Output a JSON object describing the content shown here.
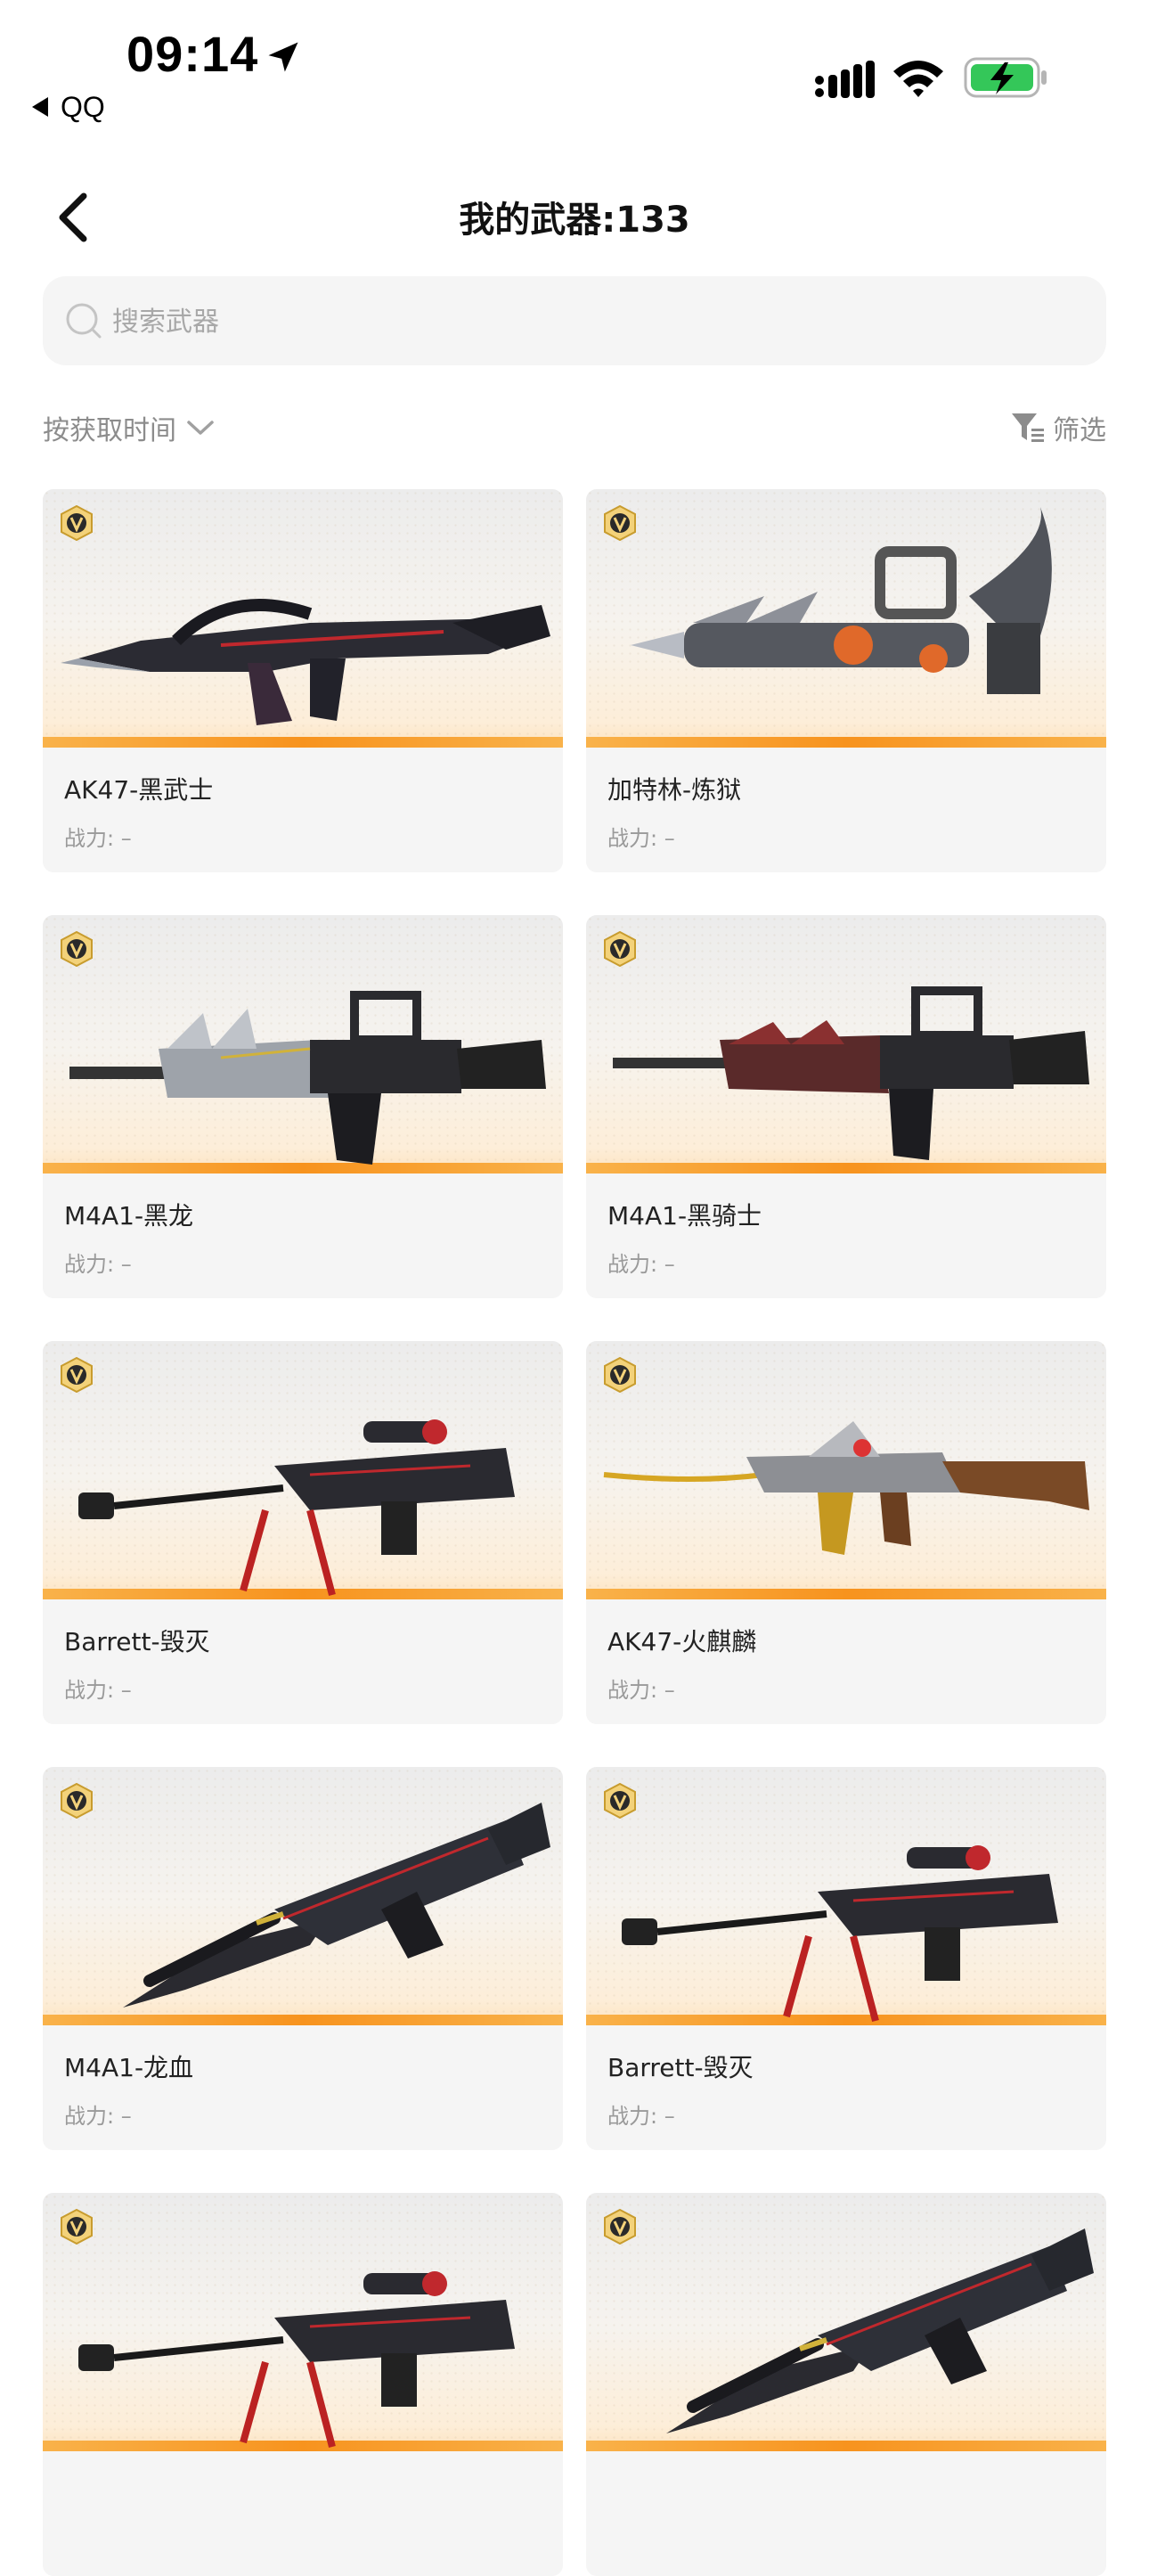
{
  "status_bar": {
    "time": "09:14",
    "back_app": "QQ"
  },
  "header": {
    "title": "我的武器:133"
  },
  "search": {
    "placeholder": "搜索武器"
  },
  "toolbar": {
    "sort_label": "按获取时间",
    "filter_label": "筛选"
  },
  "weapons": [
    {
      "name": "AK47-黑武士",
      "power": "战力: –",
      "style": "ak-dark"
    },
    {
      "name": "加特林-炼狱",
      "power": "战力: –",
      "style": "gatling"
    },
    {
      "name": "M4A1-黑龙",
      "power": "战力: –",
      "style": "m4-silver"
    },
    {
      "name": "M4A1-黑骑士",
      "power": "战力: –",
      "style": "m4-red"
    },
    {
      "name": "Barrett-毁灭",
      "power": "战力: –",
      "style": "barrett"
    },
    {
      "name": "AK47-火麒麟",
      "power": "战力: –",
      "style": "ak-gold"
    },
    {
      "name": "M4A1-龙血",
      "power": "战力: –",
      "style": "m4-blade"
    },
    {
      "name": "Barrett-毁灭",
      "power": "战力: –",
      "style": "barrett"
    },
    {
      "name": "",
      "power": "",
      "style": "barrett"
    },
    {
      "name": "",
      "power": "",
      "style": "m4-blade"
    }
  ],
  "colors": {
    "accent_bar": "#f7931e",
    "card_bg": "#f5f5f5"
  }
}
